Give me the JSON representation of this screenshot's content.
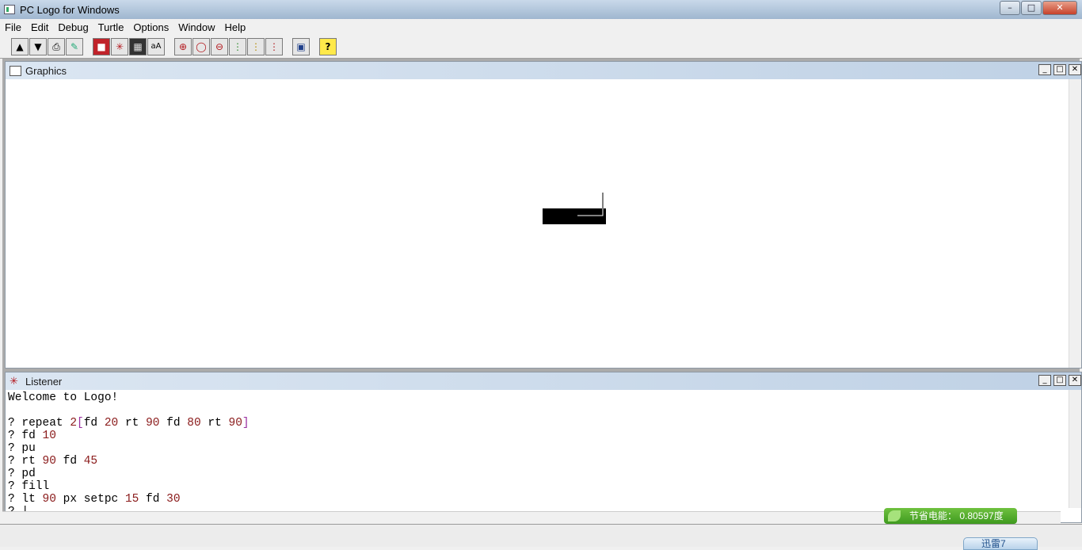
{
  "window": {
    "title": "PC Logo for Windows",
    "controls": [
      "minimize",
      "maximize",
      "close"
    ]
  },
  "menu": [
    {
      "label": "File"
    },
    {
      "label": "Edit"
    },
    {
      "label": "Debug"
    },
    {
      "label": "Turtle"
    },
    {
      "label": "Options"
    },
    {
      "label": "Window"
    },
    {
      "label": "Help"
    }
  ],
  "toolbar": {
    "buttons": [
      {
        "name": "load-icon"
      },
      {
        "name": "save-icon"
      },
      {
        "name": "print-icon"
      },
      {
        "name": "edit-icon"
      },
      {
        "name": "stop-icon"
      },
      {
        "name": "turtle-icon"
      },
      {
        "name": "pattern-icon"
      },
      {
        "name": "font-icon"
      },
      {
        "name": "zoom-in-icon"
      },
      {
        "name": "zoom-normal-icon"
      },
      {
        "name": "zoom-out-icon"
      },
      {
        "name": "traffic-light-green-icon"
      },
      {
        "name": "traffic-light-yellow-icon"
      },
      {
        "name": "traffic-light-red-icon"
      },
      {
        "name": "screen-icon"
      },
      {
        "name": "help-icon"
      }
    ]
  },
  "graphics": {
    "title": "Graphics"
  },
  "listener": {
    "title": "Listener",
    "lines": [
      [
        {
          "t": "Welcome to Logo!",
          "c": "txt"
        }
      ],
      [],
      [
        {
          "t": "? repeat ",
          "c": "txt"
        },
        {
          "t": "2",
          "c": "num"
        },
        {
          "t": "[",
          "c": "brk"
        },
        {
          "t": "fd ",
          "c": "txt"
        },
        {
          "t": "20",
          "c": "num"
        },
        {
          "t": " rt ",
          "c": "txt"
        },
        {
          "t": "90",
          "c": "num"
        },
        {
          "t": " fd ",
          "c": "txt"
        },
        {
          "t": "80",
          "c": "num"
        },
        {
          "t": " rt ",
          "c": "txt"
        },
        {
          "t": "90",
          "c": "num"
        },
        {
          "t": "]",
          "c": "brk"
        }
      ],
      [
        {
          "t": "? fd ",
          "c": "txt"
        },
        {
          "t": "10",
          "c": "num"
        }
      ],
      [
        {
          "t": "? pu",
          "c": "txt"
        }
      ],
      [
        {
          "t": "? rt ",
          "c": "txt"
        },
        {
          "t": "90",
          "c": "num"
        },
        {
          "t": " fd ",
          "c": "txt"
        },
        {
          "t": "45",
          "c": "num"
        }
      ],
      [
        {
          "t": "? pd",
          "c": "txt"
        }
      ],
      [
        {
          "t": "? fill",
          "c": "txt"
        }
      ],
      [
        {
          "t": "? lt ",
          "c": "txt"
        },
        {
          "t": "90",
          "c": "num"
        },
        {
          "t": " px setpc ",
          "c": "txt"
        },
        {
          "t": "15",
          "c": "num"
        },
        {
          "t": " fd ",
          "c": "txt"
        },
        {
          "t": "30",
          "c": "num"
        }
      ],
      [
        {
          "t": "? |",
          "c": "txt"
        }
      ]
    ]
  },
  "overlay": {
    "energy_label": "节省电能： 0.80597度",
    "thunder_label": "迅雷7"
  },
  "colors": {
    "number": "#8a1a1a",
    "bracket": "#9a2fa0",
    "title_gradient": "#bfd1e5"
  }
}
